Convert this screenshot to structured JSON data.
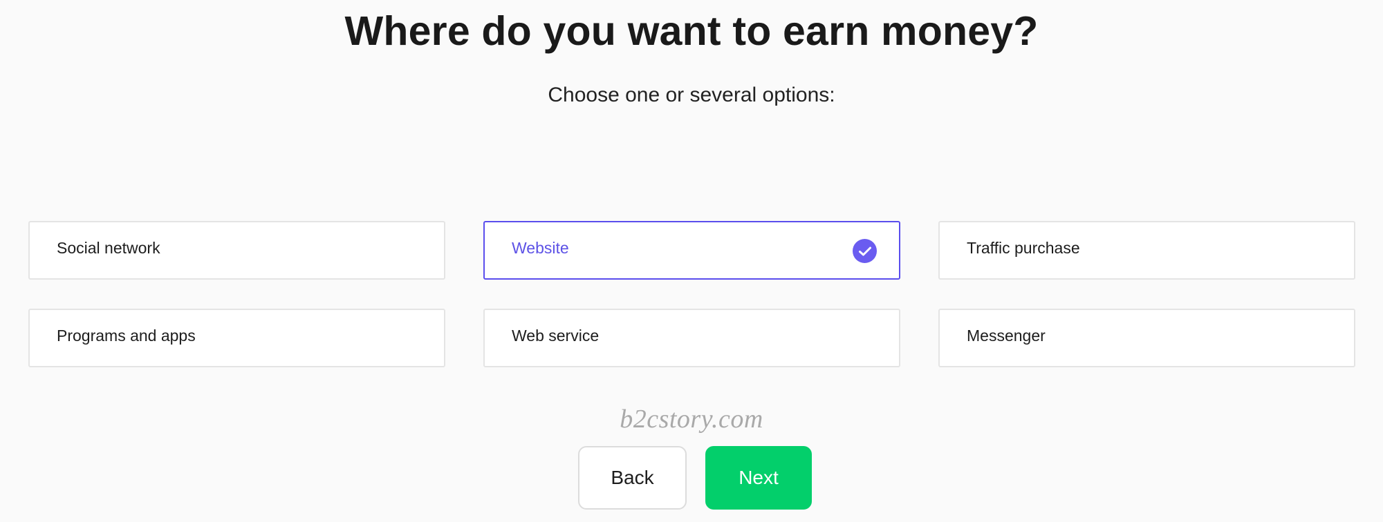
{
  "header": {
    "title": "Where do you want to earn money?",
    "subtitle": "Choose one or several options:"
  },
  "options": [
    {
      "label": "Social network",
      "selected": false
    },
    {
      "label": "Website",
      "selected": true
    },
    {
      "label": "Traffic purchase",
      "selected": false
    },
    {
      "label": "Programs and apps",
      "selected": false
    },
    {
      "label": "Web service",
      "selected": false
    },
    {
      "label": "Messenger",
      "selected": false
    }
  ],
  "watermark": "b2cstory.com",
  "actions": {
    "back_label": "Back",
    "next_label": "Next"
  },
  "colors": {
    "accent": "#5a4ded",
    "check_fill": "#6a5cf0",
    "next_button": "#03cf6b",
    "background": "#fafafa"
  },
  "icons": {
    "selected_indicator": "check-circle-icon"
  }
}
